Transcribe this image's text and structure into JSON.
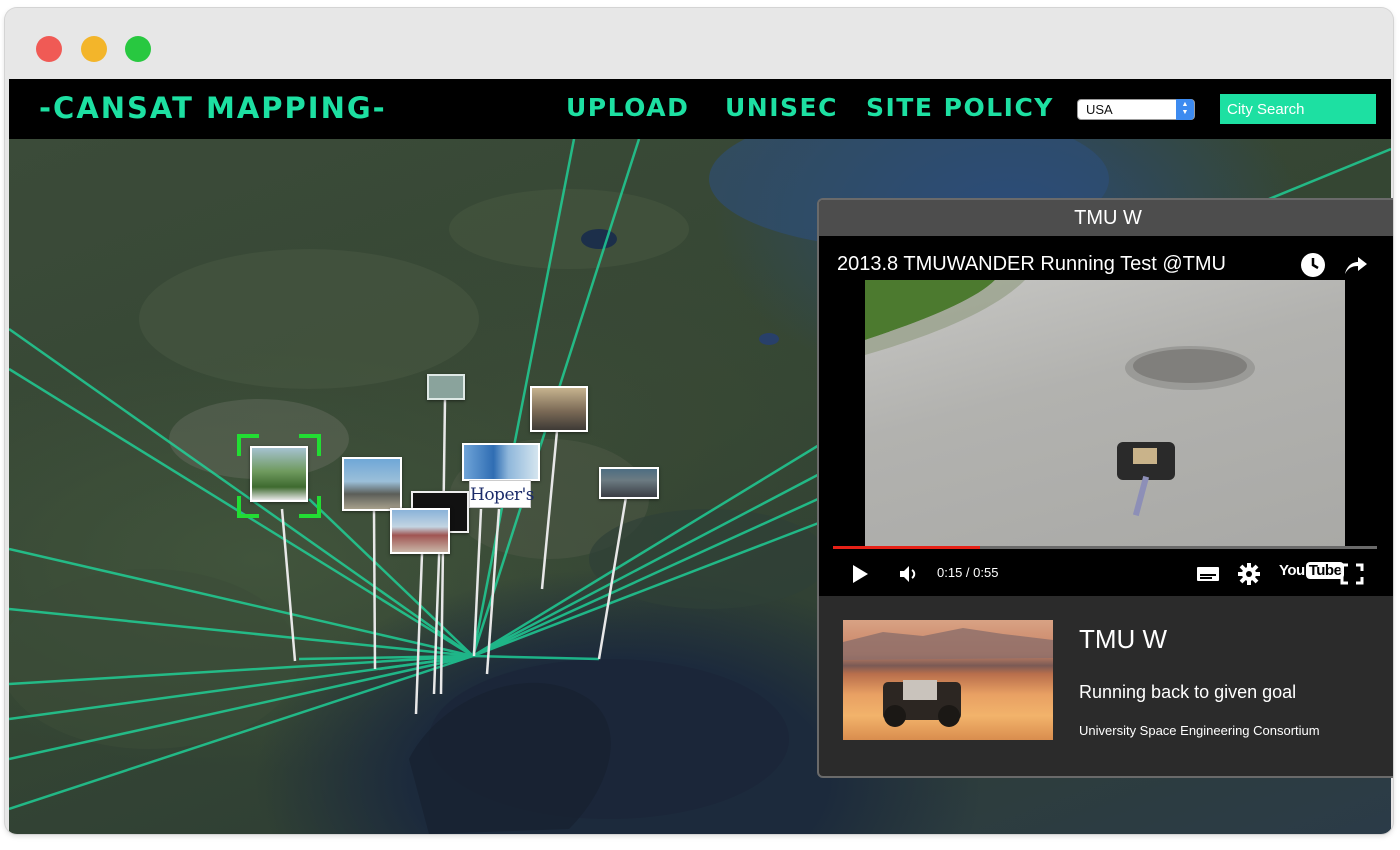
{
  "app": {
    "brand": "-CANSAT MAPPING-",
    "accent_color": "#1de0a2"
  },
  "nav": {
    "links": [
      {
        "label": "UPLOAD"
      },
      {
        "label": "UNISEC"
      },
      {
        "label": "SITE POLICY"
      }
    ],
    "country_select": {
      "value": "USA"
    },
    "city_search": {
      "placeholder": "City Search",
      "value": ""
    }
  },
  "map": {
    "view": "satellite globe view of Kanto region, Japan",
    "line_color": "#1de0a2",
    "markers": [
      {
        "name": "selected team photo",
        "selected": true
      },
      {
        "name": "team photo"
      },
      {
        "name": "team photo"
      },
      {
        "name": "team photo"
      },
      {
        "name": "team photo"
      },
      {
        "name": "team photo"
      },
      {
        "name": "Hopers team logo",
        "label": "Hoper's"
      },
      {
        "name": "team photo"
      },
      {
        "name": "team photo"
      }
    ]
  },
  "panel": {
    "header_title": "TMU W",
    "video": {
      "title": "2013.8 TMUWANDER Running Test @TMU",
      "time": "0:15 / 0:55",
      "progress": 0.27,
      "progress_color": "#e62117",
      "youtube_label": "You",
      "youtube_label_tube": "Tube",
      "icons": [
        "watch-later-icon",
        "share-icon",
        "play-icon",
        "volume-icon",
        "captions-icon",
        "settings-icon",
        "fullscreen-icon"
      ]
    },
    "info": {
      "title": "TMU W",
      "description": "Running back to given goal",
      "organization": "University Space Engineering Consortium"
    }
  }
}
